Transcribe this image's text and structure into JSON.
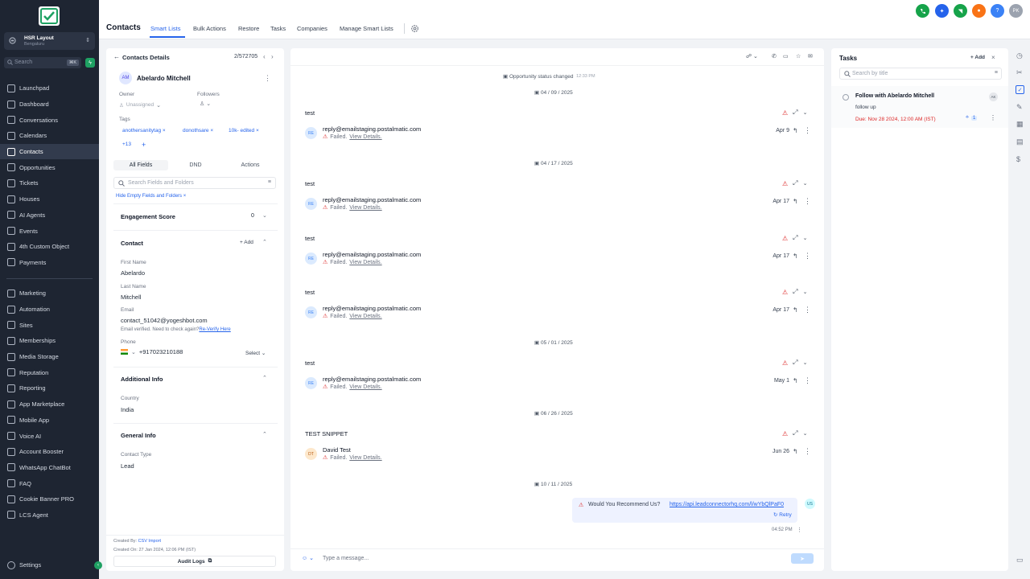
{
  "sidebar": {
    "location_name": "HSR Layout",
    "location_city": "Bengaluru",
    "search_placeholder": "Search",
    "search_shortcut": "⌘K",
    "items": [
      {
        "label": "Launchpad"
      },
      {
        "label": "Dashboard"
      },
      {
        "label": "Conversations"
      },
      {
        "label": "Calendars"
      },
      {
        "label": "Contacts",
        "active": true
      },
      {
        "label": "Opportunities"
      },
      {
        "label": "Tickets"
      },
      {
        "label": "Houses"
      },
      {
        "label": "AI Agents"
      },
      {
        "label": "Events"
      },
      {
        "label": "4th Custom Object"
      },
      {
        "label": "Payments"
      }
    ],
    "items2": [
      {
        "label": "Marketing"
      },
      {
        "label": "Automation"
      },
      {
        "label": "Sites"
      },
      {
        "label": "Memberships"
      },
      {
        "label": "Media Storage"
      },
      {
        "label": "Reputation"
      },
      {
        "label": "Reporting"
      },
      {
        "label": "App Marketplace"
      },
      {
        "label": "Mobile App"
      },
      {
        "label": "Voice AI"
      },
      {
        "label": "Account Booster"
      },
      {
        "label": "WhatsApp ChatBot"
      },
      {
        "label": "FAQ"
      },
      {
        "label": "Cookie Banner PRO"
      },
      {
        "label": "LCS Agent"
      }
    ],
    "settings_label": "Settings"
  },
  "topbar": {
    "title": "Contacts",
    "tabs": [
      "Smart Lists",
      "Bulk Actions",
      "Restore",
      "Tasks",
      "Companies",
      "Manage Smart Lists"
    ],
    "user_initials": "PK",
    "help_label": "?"
  },
  "contact": {
    "header_label": "Contacts Details",
    "position": "2/572705",
    "initials": "AM",
    "name": "Abelardo Mitchell",
    "owner_label": "Owner",
    "owner_value": "Unassigned",
    "followers_label": "Followers",
    "tags_label": "Tags",
    "tags": [
      "anothersanitytag",
      "donothsare",
      "10k- edited"
    ],
    "more_tags": "+13",
    "add_tag": "+",
    "subtabs": [
      "All Fields",
      "DND",
      "Actions"
    ],
    "search_placeholder": "Search Fields and Folders",
    "hide_empty": "Hide Empty Fields and Folders",
    "engagement_label": "Engagement Score",
    "engagement_value": "0",
    "contact_section": "Contact",
    "add_label": "Add",
    "first_name_label": "First Name",
    "first_name": "Abelardo",
    "last_name_label": "Last Name",
    "last_name": "Mitchell",
    "email_label": "Email",
    "email": "contact_51042@yogeshbot.com",
    "email_note": "Email verified. Need to check again?",
    "reverify": "Re-Verify Here",
    "phone_label": "Phone",
    "phone": "+917023210188",
    "phone_select": "Select",
    "additional_section": "Additional Info",
    "country_label": "Country",
    "country": "India",
    "general_section": "General Info",
    "contact_type_label": "Contact Type",
    "contact_type": "Lead",
    "created_by_label": "Created By:",
    "created_by": "CSV Import",
    "created_on_label": "Created On:",
    "created_on": "27 Jan 2024, 12:06 PM (IST)",
    "audit_logs": "Audit Logs"
  },
  "conversation": {
    "status_text": "Opportunity status changed",
    "status_time": "12:33 PM",
    "dates": [
      "04 / 09 / 2025",
      "04 / 17 / 2025",
      "05 / 01 / 2025",
      "06 / 26 / 2025",
      "10 / 11 / 2025"
    ],
    "failed_text": "Failed.",
    "view_details": "View Details.",
    "messages": [
      {
        "subject": "test",
        "initials": "RE",
        "from": "reply@emailstaging.postalmatic.com",
        "date": "Apr 9"
      },
      {
        "subject": "test",
        "initials": "RE",
        "from": "reply@emailstaging.postalmatic.com",
        "date": "Apr 17"
      },
      {
        "subject": "test",
        "initials": "RE",
        "from": "reply@emailstaging.postalmatic.com",
        "date": "Apr 17"
      },
      {
        "subject": "test",
        "initials": "RE",
        "from": "reply@emailstaging.postalmatic.com",
        "date": "Apr 17"
      },
      {
        "subject": "test",
        "initials": "RE",
        "from": "reply@emailstaging.postalmatic.com",
        "date": "May 1"
      },
      {
        "subject": "TEST SNIPPET",
        "initials": "DT",
        "from": "David Test",
        "date": "Jun 26"
      }
    ],
    "outgoing_text": "Would You Recommend Us?",
    "outgoing_link": "https://api.leadconnectorhq.com/l/wYbQlPaF0",
    "outgoing_initials": "US",
    "retry_label": "Retry",
    "outgoing_time": "04:52 PM",
    "composer_placeholder": "Type a message..."
  },
  "tasks": {
    "title": "Tasks",
    "add_label": "Add",
    "search_placeholder": "Search by title",
    "items": [
      {
        "title": "Follow with Abelardo Mitchell",
        "desc": "follow up",
        "due": "Due: Nov 28 2024, 12:00 AM (IST)",
        "assignee": "AK",
        "count": "1"
      }
    ]
  },
  "colors": {
    "accent": "#2563eb",
    "sidebar_bg": "#1e2532",
    "danger": "#dc2626",
    "success": "#1fa163"
  }
}
